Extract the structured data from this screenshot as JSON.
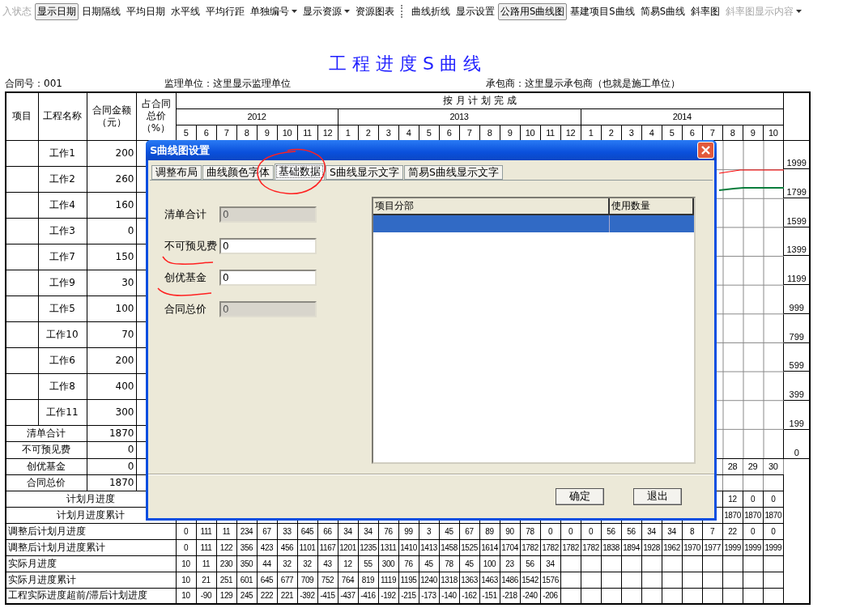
{
  "toolbar": {
    "groups": [
      [
        {
          "label": "入状态",
          "kind": "button",
          "pressed": false,
          "disabled": true
        },
        {
          "label": "显示日期",
          "kind": "button",
          "pressed": true,
          "disabled": false
        },
        {
          "label": "日期隔线",
          "kind": "button",
          "pressed": false,
          "disabled": false
        },
        {
          "label": "平均日期",
          "kind": "button",
          "pressed": false,
          "disabled": false
        },
        {
          "label": "水平线",
          "kind": "button",
          "pressed": false,
          "disabled": false
        },
        {
          "label": "平均行距",
          "kind": "button",
          "pressed": false,
          "disabled": false
        },
        {
          "label": "单独编号",
          "kind": "dropdown",
          "pressed": false,
          "disabled": false
        },
        {
          "label": "显示资源",
          "kind": "dropdown",
          "pressed": false,
          "disabled": false
        },
        {
          "label": "资源图表",
          "kind": "button",
          "pressed": false,
          "disabled": false
        }
      ],
      [
        {
          "label": "曲线折线",
          "kind": "button",
          "pressed": false,
          "disabled": false
        },
        {
          "label": "显示设置",
          "kind": "button",
          "pressed": false,
          "disabled": false
        },
        {
          "label": "公路用S曲线图",
          "kind": "button",
          "pressed": true,
          "disabled": false
        },
        {
          "label": "基建项目S曲线",
          "kind": "button",
          "pressed": false,
          "disabled": false
        },
        {
          "label": "简易S曲线",
          "kind": "button",
          "pressed": false,
          "disabled": false
        },
        {
          "label": "斜率图",
          "kind": "button",
          "pressed": false,
          "disabled": false
        },
        {
          "label": "斜率图显示内容",
          "kind": "dropdown",
          "pressed": false,
          "disabled": true
        }
      ]
    ]
  },
  "sheet": {
    "title": "工 程 进 度 S 曲 线",
    "contract_no": "合同号：001",
    "supervisor": "监理单位：这里显示监理单位",
    "contractor": "承包商：这里显示承包商（也就是施工单位）",
    "columns": [
      {
        "lines": [
          "项目"
        ]
      },
      {
        "lines": [
          "工程名称"
        ]
      },
      {
        "lines": [
          "合同金额",
          "（元）"
        ]
      },
      {
        "lines": [
          "占合同",
          "总价",
          "（%）"
        ]
      }
    ],
    "plan_heading": "按 月 计 划 完 成",
    "years": [
      {
        "label": "2012",
        "months": [
          "5",
          "6",
          "7",
          "8",
          "9",
          "10",
          "11",
          "12"
        ]
      },
      {
        "label": "2013",
        "months": [
          "1",
          "2",
          "3",
          "4",
          "5",
          "6",
          "7",
          "8",
          "9",
          "10",
          "11",
          "12"
        ]
      },
      {
        "label": "2014",
        "months": [
          "1",
          "2",
          "3",
          "4",
          "5",
          "6",
          "7",
          "8",
          "9",
          "10"
        ]
      }
    ],
    "works": [
      {
        "name": "工作1",
        "amount": "200"
      },
      {
        "name": "工作2",
        "amount": "260"
      },
      {
        "name": "工作4",
        "amount": "160"
      },
      {
        "name": "工作3",
        "amount": "0"
      },
      {
        "name": "工作7",
        "amount": "150"
      },
      {
        "name": "工作9",
        "amount": "30"
      },
      {
        "name": "工作5",
        "amount": "100"
      },
      {
        "name": "工作10",
        "amount": "70"
      },
      {
        "name": "工作6",
        "amount": "200"
      },
      {
        "name": "工作8",
        "amount": "400"
      },
      {
        "name": "工作11",
        "amount": "300"
      }
    ],
    "axis_labels": [
      "1999",
      "1799",
      "1599",
      "1399",
      "1199",
      "999",
      "799",
      "599",
      "399",
      "199",
      "0"
    ],
    "summary": [
      {
        "label": "清单合计",
        "amount": "1870"
      },
      {
        "label": "不可预见费",
        "amount": "0"
      },
      {
        "label": "创优基金",
        "amount": "0",
        "month_values": [
          "28",
          "29",
          "30"
        ]
      },
      {
        "label": "合同总价",
        "amount": "1870"
      }
    ],
    "progress_rows": [
      {
        "label": "计划月进度",
        "kind": "plan",
        "values": [
          "12",
          "0",
          "0"
        ]
      },
      {
        "label": "计划月进度累计",
        "kind": "plan",
        "values": [
          "1870",
          "1870",
          "1870"
        ]
      },
      {
        "label": "调整后计划月进度",
        "kind": "detail",
        "values": [
          "0",
          "111",
          "11",
          "234",
          "67",
          "33",
          "645",
          "66",
          "34",
          "34",
          "76",
          "99",
          "3",
          "45",
          "67",
          "89",
          "90",
          "78",
          "0",
          "0",
          "0",
          "56",
          "56",
          "34",
          "34",
          "8",
          "7",
          "22",
          "0",
          "0"
        ]
      },
      {
        "label": "调整后计划月进度累计",
        "kind": "detail",
        "values": [
          "0",
          "111",
          "122",
          "356",
          "423",
          "456",
          "1101",
          "1167",
          "1201",
          "1235",
          "1311",
          "1410",
          "1413",
          "1458",
          "1525",
          "1614",
          "1704",
          "1782",
          "1782",
          "1782",
          "1782",
          "1838",
          "1894",
          "1928",
          "1962",
          "1970",
          "1977",
          "1999",
          "1999",
          "1999"
        ]
      },
      {
        "label": "实际月进度",
        "kind": "detail",
        "values": [
          "10",
          "11",
          "230",
          "350",
          "44",
          "32",
          "32",
          "43",
          "12",
          "55",
          "300",
          "76",
          "45",
          "78",
          "45",
          "100",
          "23",
          "56",
          "34"
        ]
      },
      {
        "label": "实际月进度累计",
        "kind": "detail",
        "values": [
          "10",
          "21",
          "251",
          "601",
          "645",
          "677",
          "709",
          "752",
          "764",
          "819",
          "1119",
          "1195",
          "1240",
          "1318",
          "1363",
          "1463",
          "1486",
          "1542",
          "1576"
        ]
      },
      {
        "label": "工程实际进度超前/滞后计划进度",
        "kind": "detail",
        "values": [
          "10",
          "-90",
          "129",
          "245",
          "222",
          "221",
          "-392",
          "-415",
          "-437",
          "-416",
          "-192",
          "-215",
          "-173",
          "-140",
          "-162",
          "-151",
          "-218",
          "-240",
          "-206"
        ]
      }
    ]
  },
  "dialog": {
    "title": "S曲线图设置",
    "tabs": [
      {
        "label": "调整布局",
        "selected": false
      },
      {
        "label": "曲线颜色字体",
        "selected": false
      },
      {
        "label": "基础数据",
        "selected": true
      },
      {
        "label": "S曲线显示文字",
        "selected": false
      },
      {
        "label": "简易S曲线显示文字",
        "selected": false
      }
    ],
    "fields": [
      {
        "label": "清单合计",
        "value": "0",
        "disabled": true
      },
      {
        "label": "不可预见费",
        "value": "0",
        "disabled": false
      },
      {
        "label": "创优基金",
        "value": "0",
        "disabled": false
      },
      {
        "label": "合同总价",
        "value": "0",
        "disabled": true
      }
    ],
    "list": {
      "columns": [
        "项目分部",
        "使用数量"
      ],
      "rows": [
        {
          "selected": true
        }
      ]
    },
    "buttons": [
      "确定",
      "退出"
    ]
  }
}
